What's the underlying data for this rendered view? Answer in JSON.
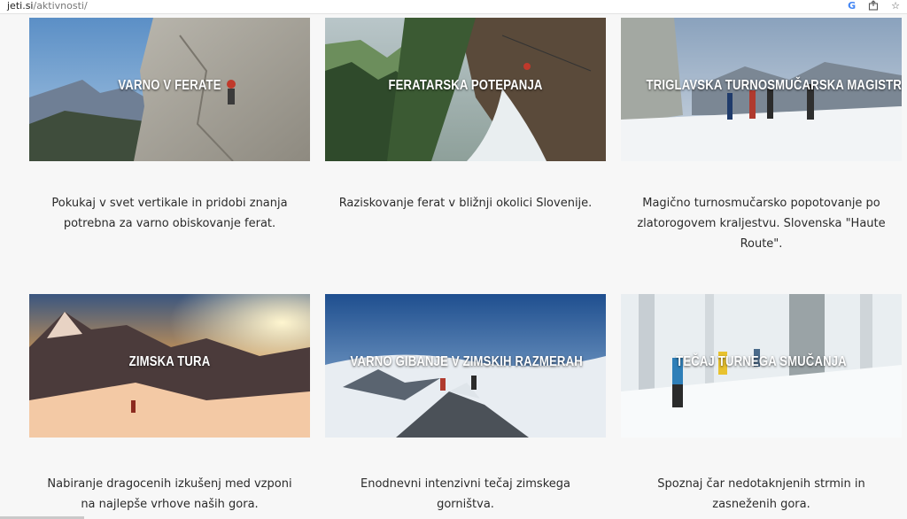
{
  "browser": {
    "url_host": "jeti.si",
    "url_path": "/aktivnosti/",
    "icons": [
      "google-icon",
      "share-icon",
      "bookmark-star-icon"
    ]
  },
  "cards": [
    {
      "title": "VARNO V FERATE",
      "desc_lines": [
        "Pokukaj v svet vertikale in pridobi znanja",
        "potrebna za varno obiskovanje ferat."
      ]
    },
    {
      "title": "FERATARSKA POTEPANJA",
      "desc_lines": [
        "Raziskovanje ferat v bližnji okolici Slovenije."
      ]
    },
    {
      "title": "TRIGLAVSKA TURNOSMUČARSKA MAGISTRALA",
      "desc_lines": [
        "Magično turnosmučarsko popotovanje po",
        "zlatorogovem kraljestvu. Slovenska \"Haute",
        "Route\"."
      ]
    },
    {
      "title": "ZIMSKA TURA",
      "desc_lines": [
        "Nabiranje dragocenih izkušenj med vzponi",
        "na najlepše vrhove naših gora."
      ]
    },
    {
      "title": "VARNO GIBANJE V ZIMSKIH RAZMERAH",
      "desc_lines": [
        "Enodnevni intenzivni tečaj zimskega",
        "gorništva."
      ]
    },
    {
      "title": "TEČAJ TURNEGA SMUČANJA",
      "desc_lines": [
        "Spoznaj čar nedotaknjenih strmin in",
        "zasneženih gora."
      ]
    }
  ]
}
